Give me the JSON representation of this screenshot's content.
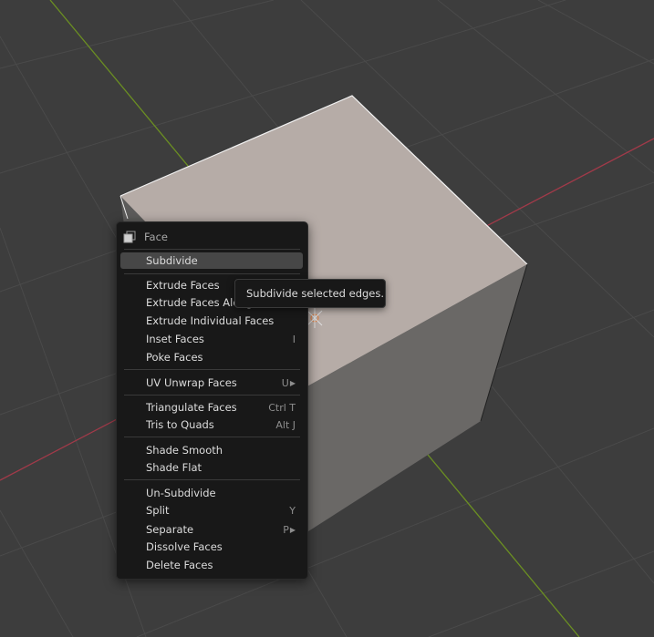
{
  "menu": {
    "title": "Face",
    "items": [
      {
        "label": "Subdivide",
        "shortcut": ""
      },
      {
        "label": "Extrude Faces",
        "shortcut": ""
      },
      {
        "label": "Extrude Faces Along Normals",
        "shortcut": ""
      },
      {
        "label": "Extrude Individual Faces",
        "shortcut": ""
      },
      {
        "label": "Inset Faces",
        "shortcut": "I"
      },
      {
        "label": "Poke Faces",
        "shortcut": ""
      },
      {
        "label": "UV Unwrap Faces",
        "shortcut": "U"
      },
      {
        "label": "Triangulate Faces",
        "shortcut": "Ctrl T"
      },
      {
        "label": "Tris to Quads",
        "shortcut": "Alt J"
      },
      {
        "label": "Shade Smooth",
        "shortcut": ""
      },
      {
        "label": "Shade Flat",
        "shortcut": ""
      },
      {
        "label": "Un-Subdivide",
        "shortcut": ""
      },
      {
        "label": "Split",
        "shortcut": "Y"
      },
      {
        "label": "Separate",
        "shortcut": "P"
      },
      {
        "label": "Dissolve Faces",
        "shortcut": ""
      },
      {
        "label": "Delete Faces",
        "shortcut": ""
      }
    ]
  },
  "tooltip": {
    "text": "Subdivide selected edges."
  },
  "colors": {
    "viewport_bg": "#3d3d3d",
    "x_axis": "#a13a49",
    "y_axis": "#6b8f22",
    "menu_bg": "#181818",
    "highlight": "#474747",
    "cube_top": "#b6aca7"
  }
}
